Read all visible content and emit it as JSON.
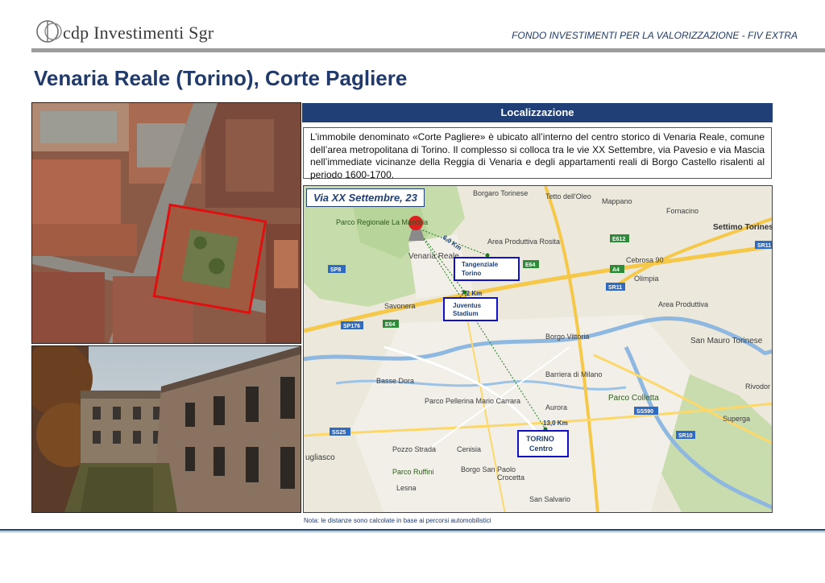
{
  "header": {
    "logo_text": "cdp Investimenti Sgr",
    "fund_title": "FONDO INVESTIMENTI PER LA VALORIZZAZIONE - FIV EXTRA"
  },
  "page": {
    "title": "Venaria Reale (Torino), Corte Pagliere"
  },
  "localization": {
    "header": "Localizzazione",
    "description": "L’immobile denominato «Corte Pagliere» è ubicato all’interno del centro storico di Venaria Reale, comune dell’area metropolitana di Torino. Il complesso si colloca tra le vie XX Settembre, via Pavesio e via Mascia nell’immediate vicinanze della Reggia di Venaria e degli appartamenti reali di Borgo Castello risalenti al periodo 1600-1700."
  },
  "map": {
    "address_label": "Via XX Settembre, 23",
    "destinations": [
      {
        "name_line1": "Tangenziale",
        "name_line2": "Torino",
        "distance": "6,0 Km"
      },
      {
        "name_line1": "Juventus",
        "name_line2": "Stadium",
        "distance": "7,2 Km"
      },
      {
        "name_line1": "TORINO",
        "name_line2": "Centro",
        "distance": "13,0 Km"
      }
    ],
    "place_names": [
      "Borgaro Torinese",
      "Tetto dell'Oleo",
      "Mappano",
      "Fornacino",
      "Settimo Torinese",
      "Parco Regionale La Mandria",
      "Venaria Reale",
      "Area Produttiva Rosita",
      "Cebrosa 90",
      "Olimpia",
      "Area Produttiva",
      "San Mauro Torinese",
      "Savonera",
      "Borgo Vittoria",
      "Basse Dora",
      "Barriera di Milano",
      "Parco Pellerina Mario Carrara",
      "Parco Colletta",
      "Aurora",
      "Superga",
      "Pozzo Strada",
      "Cenisia",
      "Borgo San Paolo",
      "Parco Ruffini",
      "Lesna",
      "Crocetta",
      "San Salvario",
      "ugliasco",
      "Rivodor"
    ],
    "road_labels": [
      "SP8",
      "SP176",
      "E64",
      "E612",
      "A4",
      "SR11",
      "SS25",
      "SS590",
      "SR10",
      "E64",
      "SR11"
    ]
  },
  "note": "Nota: le distanze sono calcolate in base ai percorsi automobilistici",
  "colors": {
    "brand_blue": "#1f3f76",
    "callout_border": "#1010c8",
    "property_outline": "#e01010"
  }
}
